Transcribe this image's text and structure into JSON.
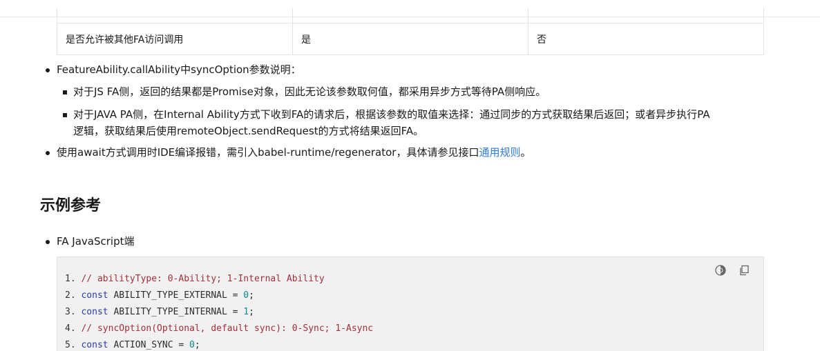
{
  "table": {
    "row": {
      "col1": "是否允许被其他FA访问调用",
      "col2": "是",
      "col3": "否"
    }
  },
  "bullets": {
    "b1": "FeatureAbility.callAbility中syncOption参数说明：",
    "b1_sub1": "对于JS FA侧，返回的结果都是Promise对象，因此无论该参数取何值，都采用异步方式等待PA侧响应。",
    "b1_sub2_line1": "对于JAVA PA侧，在Internal Ability方式下收到FA的请求后，根据该参数的取值来选择：通过同步的方式获取结果后返回；或者异步执行PA",
    "b1_sub2_line2": "逻辑，获取结果后使用remoteObject.sendRequest的方式将结果返回FA。",
    "b2_prefix": "使用await方式调用时IDE编译报错，需引入babel-runtime/regenerator，具体请参见接口",
    "b2_link": "通用规则",
    "b2_suffix": "。"
  },
  "section": {
    "title": "示例参考",
    "bullet": "FA JavaScript端"
  },
  "code": {
    "lines": [
      {
        "num": "1.",
        "comment": "// abilityType: 0-Ability; 1-Internal Ability"
      },
      {
        "num": "2.",
        "kw": "const",
        "rest": " ABILITY_TYPE_EXTERNAL = ",
        "val": "0",
        "end": ";"
      },
      {
        "num": "3.",
        "kw": "const",
        "rest": " ABILITY_TYPE_INTERNAL = ",
        "val": "1",
        "end": ";"
      },
      {
        "num": "4.",
        "comment": "// syncOption(Optional, default sync): 0-Sync; 1-Async"
      },
      {
        "num": "5.",
        "kw": "const",
        "rest": " ACTION_SYNC = ",
        "val": "0",
        "end": ";"
      }
    ]
  },
  "icons": {
    "theme": "theme-toggle-icon",
    "copy": "copy-icon"
  }
}
